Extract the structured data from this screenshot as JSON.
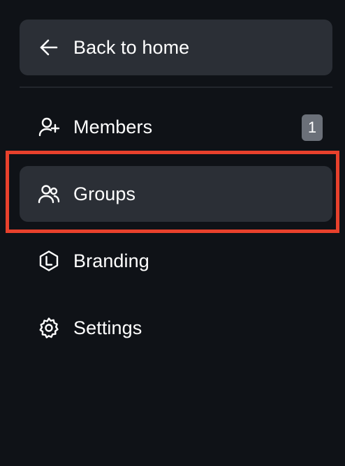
{
  "sidebar": {
    "back": {
      "label": "Back to home",
      "icon": "arrow-left-icon"
    },
    "items": [
      {
        "label": "Members",
        "icon": "user-plus-icon",
        "badge": "1",
        "active": false
      },
      {
        "label": "Groups",
        "icon": "users-icon",
        "active": true
      },
      {
        "label": "Branding",
        "icon": "hexagon-logo-icon",
        "active": false
      },
      {
        "label": "Settings",
        "icon": "gear-icon",
        "active": false
      }
    ]
  },
  "colors": {
    "background": "#0f1217",
    "active_item": "#2b2f36",
    "badge": "#6b7079",
    "highlight": "#e8412c",
    "text": "#ffffff"
  }
}
